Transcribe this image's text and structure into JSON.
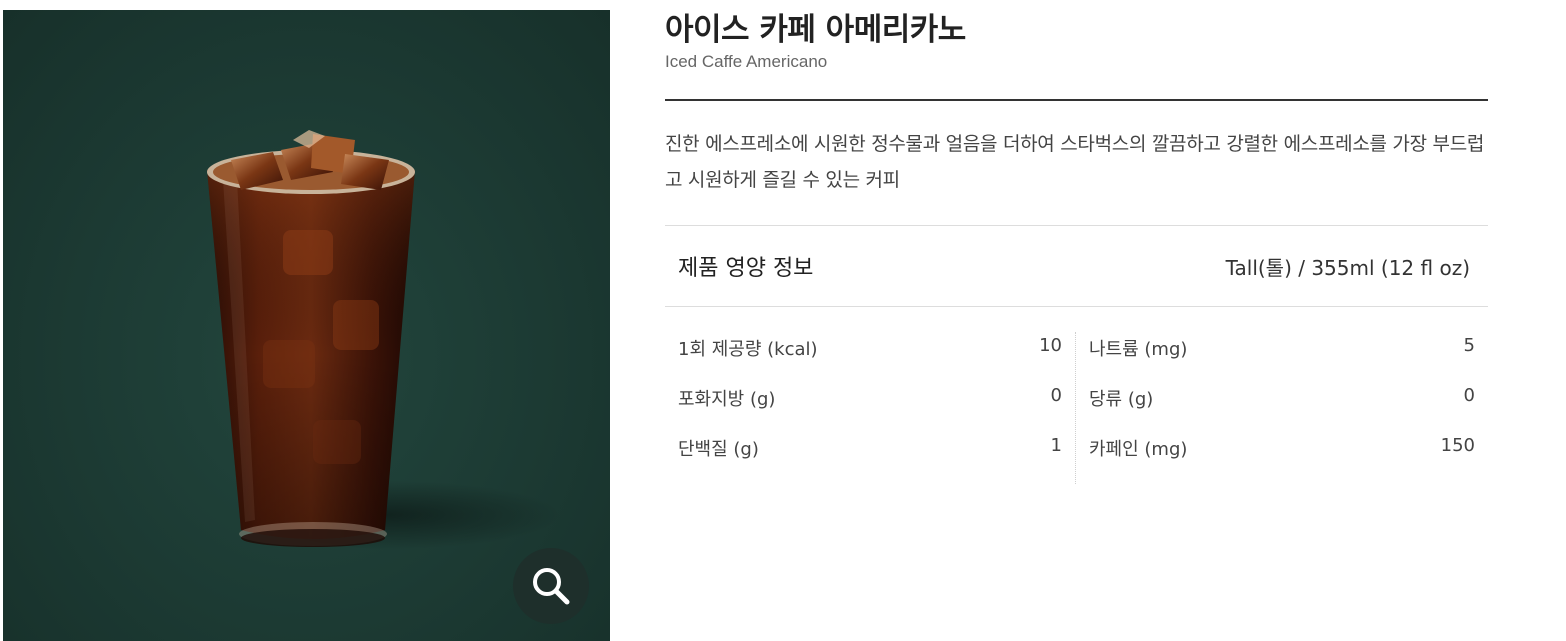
{
  "product": {
    "name_ko": "아이스 카페 아메리카노",
    "name_en": "Iced Caffe Americano",
    "description": "진한 에스프레소에 시원한 정수물과 얼음을 더하여 스타벅스의 깔끔하고 강렬한 에스프레소를 가장 부드럽고 시원하게 즐길 수 있는 커피"
  },
  "image": {
    "background_color": "#1c3a33",
    "zoom_icon": "magnifier-icon"
  },
  "nutrition": {
    "title": "제품 영양 정보",
    "size": "Tall(톨) / 355ml (12 fl oz)",
    "left": [
      {
        "label": "1회 제공량 (kcal)",
        "value": "10"
      },
      {
        "label": "포화지방 (g)",
        "value": "0"
      },
      {
        "label": "단백질 (g)",
        "value": "1"
      }
    ],
    "right": [
      {
        "label": "나트륨 (mg)",
        "value": "5"
      },
      {
        "label": "당류 (g)",
        "value": "0"
      },
      {
        "label": "카페인 (mg)",
        "value": "150"
      }
    ]
  }
}
